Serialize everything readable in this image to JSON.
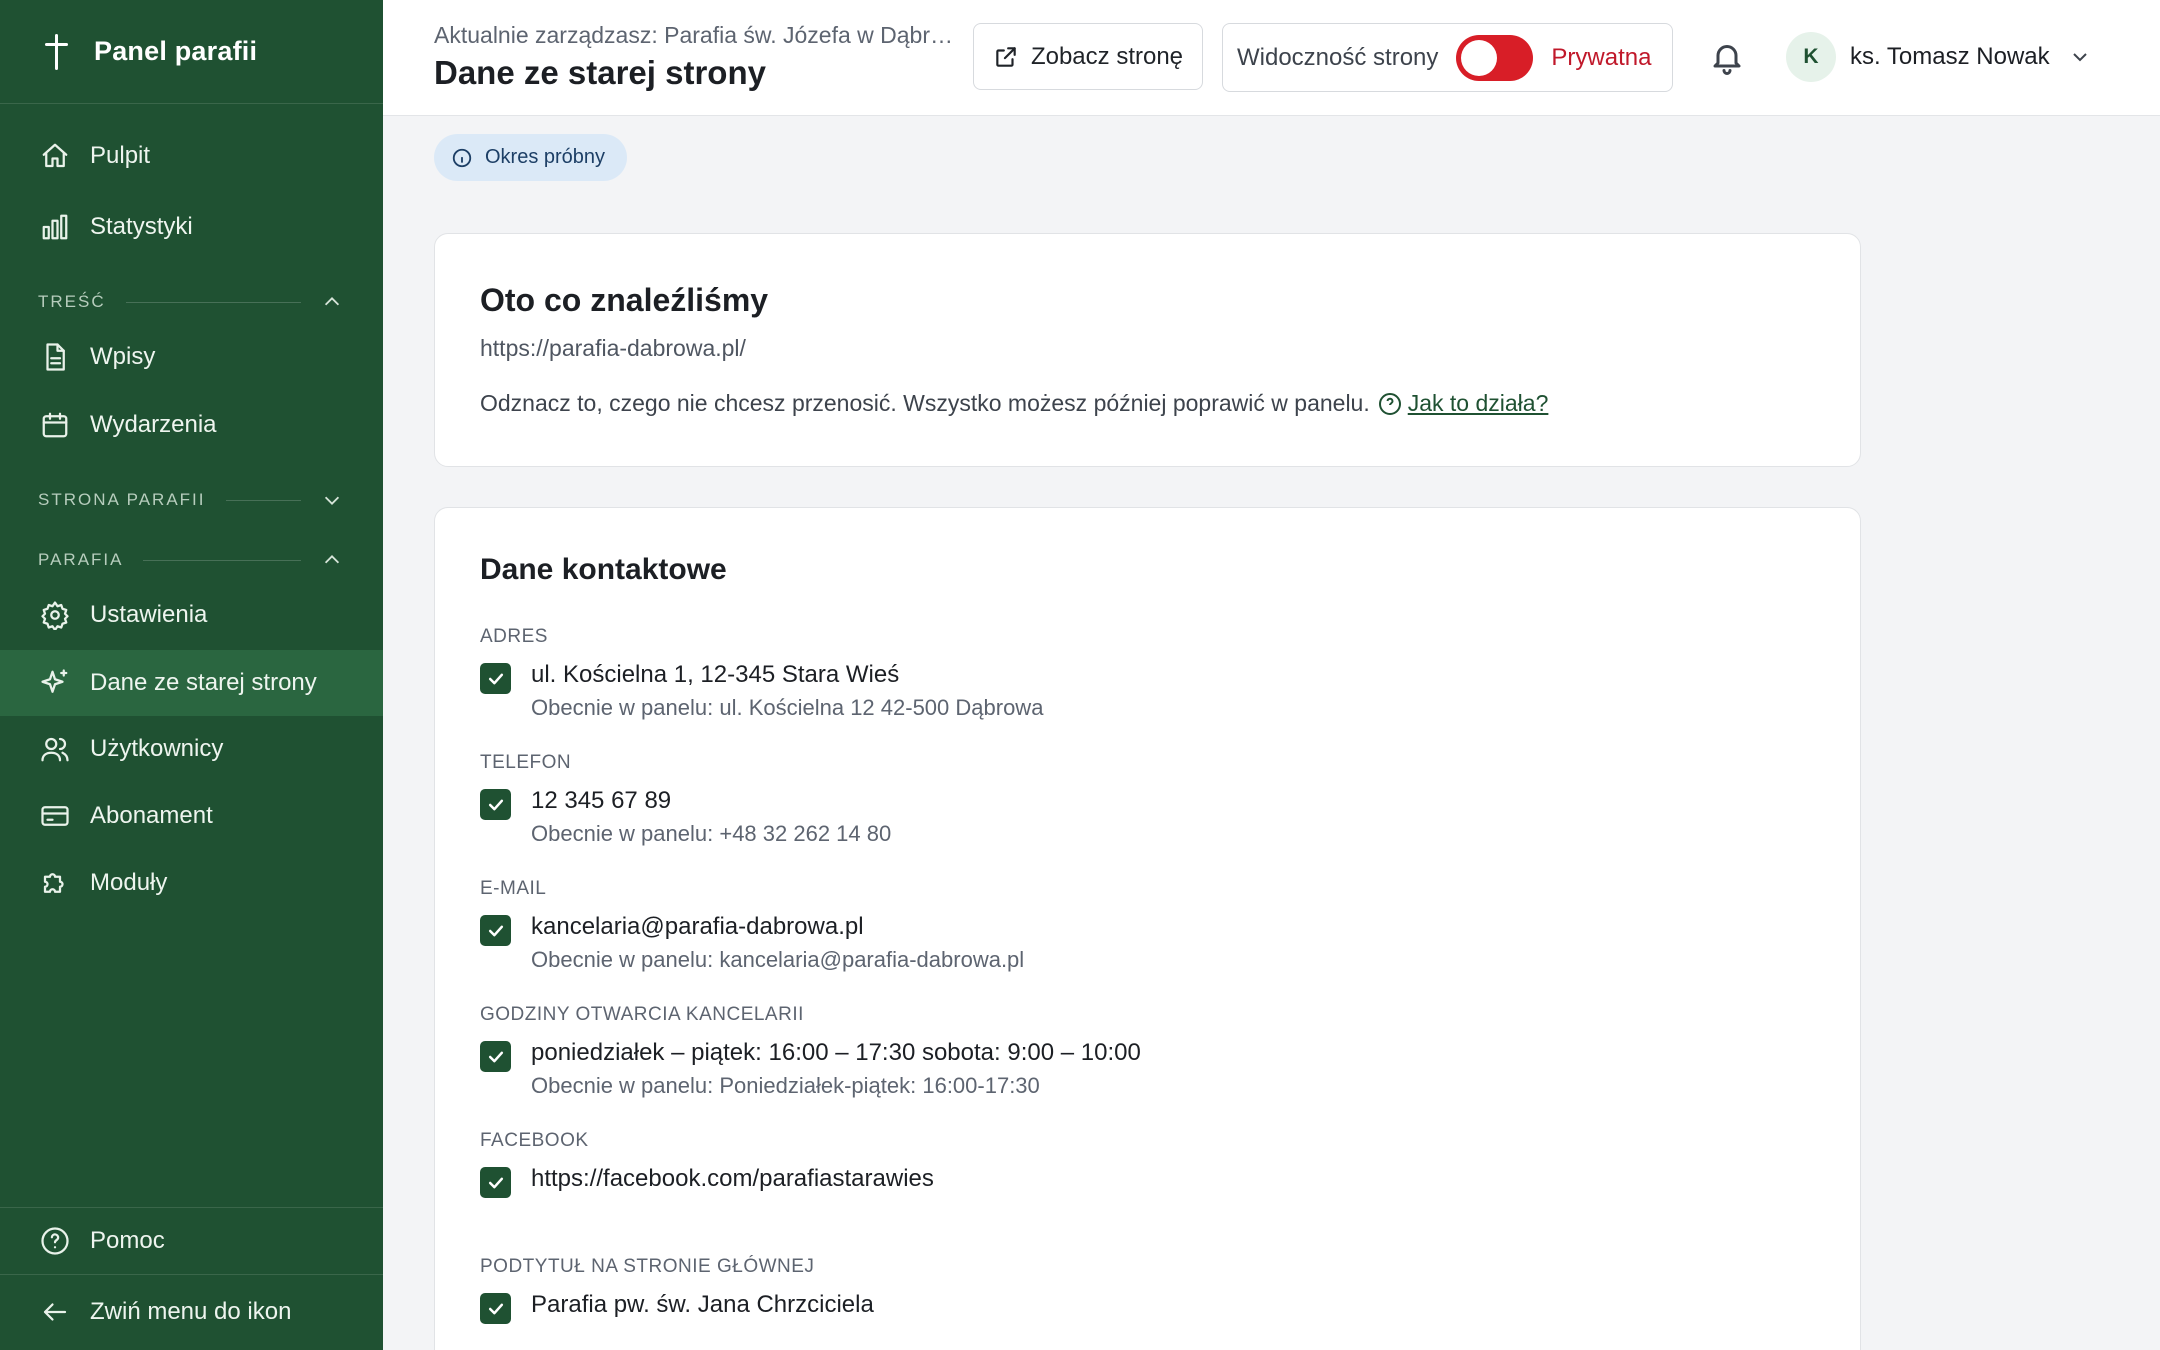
{
  "sidebar": {
    "brand": "Panel parafii",
    "items": [
      {
        "label": "Pulpit",
        "icon": "home-icon"
      },
      {
        "label": "Statystyki",
        "icon": "bar-chart-icon"
      },
      {
        "label": "Wpisy",
        "icon": "document-icon"
      },
      {
        "label": "Wydarzenia",
        "icon": "calendar-icon"
      },
      {
        "label": "Ustawienia",
        "icon": "gear-icon"
      },
      {
        "label": "Dane ze starej strony",
        "icon": "sparkles-icon"
      },
      {
        "label": "Użytkownicy",
        "icon": "users-icon"
      },
      {
        "label": "Abonament",
        "icon": "credit-card-icon"
      },
      {
        "label": "Moduły",
        "icon": "puzzle-icon"
      }
    ],
    "sections": {
      "content": "TREŚĆ",
      "site": "STRONA PARAFII",
      "parish": "PARAFIA"
    },
    "help": "Pomoc",
    "collapse": "Zwiń menu do ikon",
    "accent": "#1f5132",
    "active_bg": "#2a6640"
  },
  "topbar": {
    "managing": "Aktualnie zarządzasz: Parafia św. Józefa w Dąbrowie",
    "title": "Dane ze starej strony",
    "view_site": "Zobacz stronę",
    "visibility_label": "Widoczność strony",
    "visibility_status": "Prywatna",
    "toggle_color": "#d81e27",
    "user_initial": "K",
    "user_name": "ks. Tomasz Nowak"
  },
  "badge": "Okres próbny",
  "found": {
    "title": "Oto co znaleźliśmy",
    "url": "https://parafia-dabrowa.pl/",
    "hint": "Odznacz to, czego nie chcesz przenosić. Wszystko możesz później poprawić w panelu.",
    "help_link": "Jak to działa?"
  },
  "contact": {
    "title": "Dane kontaktowe",
    "fields": [
      {
        "label": "ADRES",
        "value": "ul. Kościelna 1, 12-345 Stara Wieś",
        "current": "Obecnie w panelu: ul. Kościelna 12 42-500 Dąbrowa",
        "checked": true
      },
      {
        "label": "TELEFON",
        "value": "12 345 67 89",
        "current": "Obecnie w panelu: +48 32 262 14 80",
        "checked": true
      },
      {
        "label": "E-MAIL",
        "value": "kancelaria@parafia-dabrowa.pl",
        "current": "Obecnie w panelu: kancelaria@parafia-dabrowa.pl",
        "checked": true
      },
      {
        "label": "GODZINY OTWARCIA KANCELARII",
        "value": "poniedziałek – piątek: 16:00 – 17:30 sobota: 9:00 – 10:00",
        "current": "Obecnie w panelu: Poniedziałek-piątek: 16:00-17:30",
        "checked": true
      },
      {
        "label": "FACEBOOK",
        "value": "https://facebook.com/parafiastarawies",
        "checked": true
      },
      {
        "label": "PODTYTUŁ NA STRONIE GŁÓWNEJ",
        "value": "Parafia pw. św. Jana Chrzciciela",
        "checked": true
      }
    ]
  }
}
